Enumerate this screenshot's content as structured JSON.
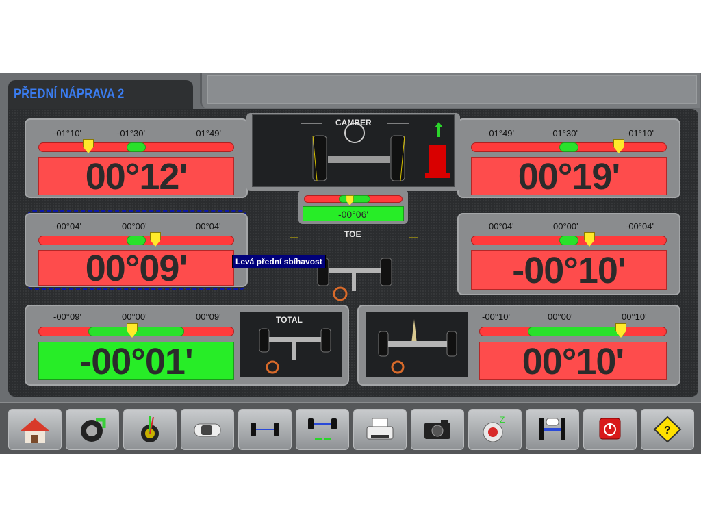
{
  "app": {
    "title": "PŘEDNÍ NÁPRAVA 2"
  },
  "camber": {
    "label": "CAMBER",
    "left": {
      "scale": [
        "-01°10'",
        "-01°30'",
        "-01°49'"
      ],
      "value": "00°12'",
      "status": "out"
    },
    "right": {
      "scale": [
        "-01°49'",
        "-01°30'",
        "-01°10'"
      ],
      "value": "00°19'",
      "status": "out"
    },
    "cross": {
      "value": "-00°06'",
      "status": "ok"
    }
  },
  "toe": {
    "label": "TOE",
    "left": {
      "scale": [
        "-00°04'",
        "00°00'",
        "00°04'"
      ],
      "value": "00°09'",
      "status": "out",
      "tooltip": "Levá přední sbíhavost"
    },
    "right": {
      "scale": [
        "00°04'",
        "00°00'",
        "-00°04'"
      ],
      "value": "-00°10'",
      "status": "out"
    }
  },
  "total": {
    "label": "TOTAL",
    "left": {
      "scale": [
        "-00°09'",
        "00°00'",
        "00°09'"
      ],
      "value": "-00°01'",
      "status": "ok"
    },
    "right": {
      "scale": [
        "-00°10'",
        "00°00'",
        "00°10'"
      ],
      "value": "00°10'",
      "status": "out"
    }
  },
  "diagram_signs": {
    "plus": "+",
    "minus": "−"
  },
  "toolbar": {
    "buttons": [
      {
        "icon": "home-icon"
      },
      {
        "icon": "wheel-change-icon"
      },
      {
        "icon": "caster-wheel-icon"
      },
      {
        "icon": "car-top-icon"
      },
      {
        "icon": "axle-icon"
      },
      {
        "icon": "axle-adjust-icon"
      },
      {
        "icon": "printer-icon"
      },
      {
        "icon": "camera-icon"
      },
      {
        "icon": "sleep-sensor-icon"
      },
      {
        "icon": "lift-icon"
      },
      {
        "icon": "power-icon"
      },
      {
        "icon": "help-icon"
      }
    ]
  },
  "colors": {
    "out": "#fe4c4c",
    "ok": "#27ed27",
    "marker": "#ffea2a",
    "title": "#3a7cf0"
  }
}
